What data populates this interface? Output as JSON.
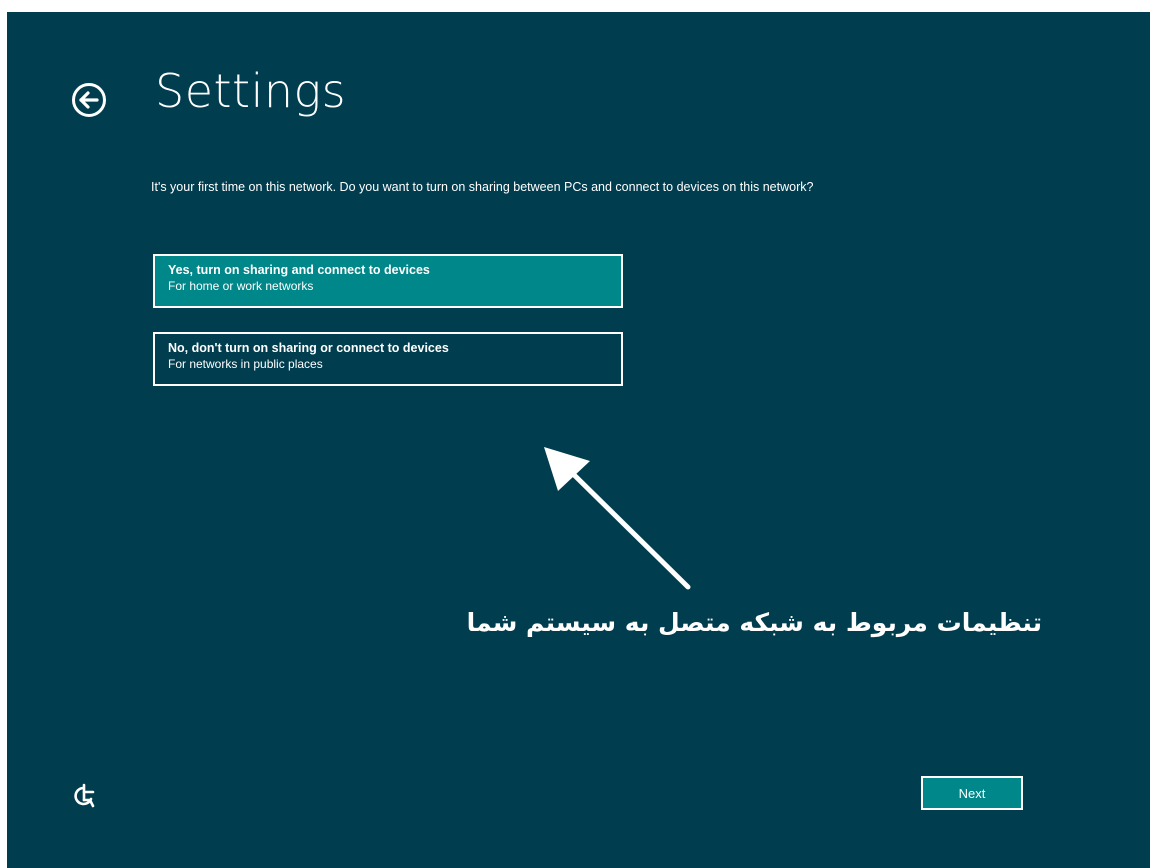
{
  "page": {
    "title": "Settings",
    "question": "It's your first time on this network. Do you want to turn on sharing between PCs and connect to devices on this network?"
  },
  "options": [
    {
      "label": "Yes, turn on sharing and connect to devices",
      "description": "For home or work networks",
      "selected": true
    },
    {
      "label": "No, don't turn on sharing or connect to devices",
      "description": "For networks in public places",
      "selected": false
    }
  ],
  "annotation": {
    "text": "تنظیمات مربوط به شبکه متصل به سیستم شما"
  },
  "footer": {
    "next_label": "Next"
  },
  "icons": {
    "back": "back-arrow-circle-icon",
    "ease_of_access": "ease-of-access-icon",
    "pointer": "annotation-arrow"
  },
  "colors": {
    "background": "#003d4f",
    "accent": "#00878a",
    "text": "#ffffff"
  }
}
